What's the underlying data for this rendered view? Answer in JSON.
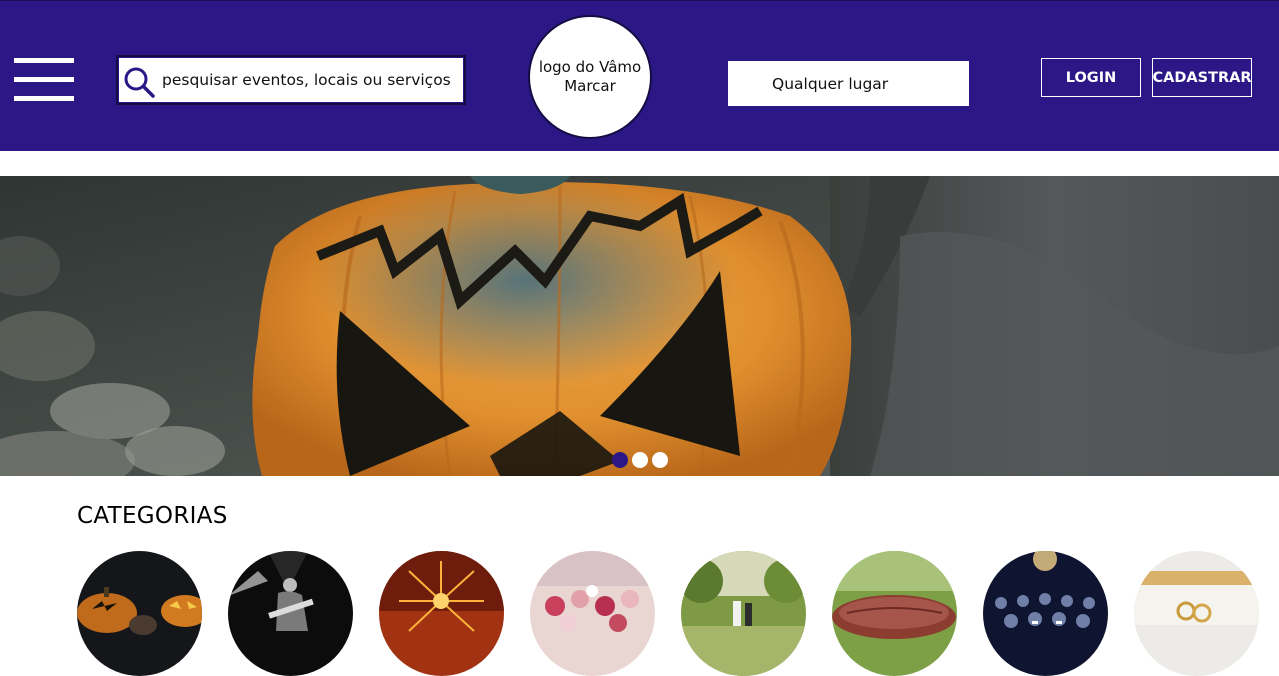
{
  "header": {
    "search": {
      "placeholder": "pesquisar eventos, locais ou serviços"
    },
    "logo": {
      "text": "logo do Vâmo Marcar"
    },
    "location": {
      "label": "Qualquer lugar"
    },
    "buttons": {
      "login": "LOGIN",
      "signup": "CADASTRAR"
    },
    "icons": {
      "menu": "hamburger-menu-icon",
      "search": "search-icon"
    }
  },
  "hero": {
    "slide_count": 3,
    "active_slide": 1
  },
  "categories": {
    "title": "CATEGORIAS",
    "items": [
      {
        "image": "halloween-pumpkins"
      },
      {
        "image": "concert-guitarist"
      },
      {
        "image": "fireworks"
      },
      {
        "image": "party-cupcakes"
      },
      {
        "image": "outdoor-wedding"
      },
      {
        "image": "grilled-ribs"
      },
      {
        "image": "cinema-audience"
      },
      {
        "image": "wedding-rings"
      }
    ]
  },
  "colors": {
    "header_bg": "#2b1786",
    "accent": "#2b1786",
    "button_text": "#ffffff"
  }
}
